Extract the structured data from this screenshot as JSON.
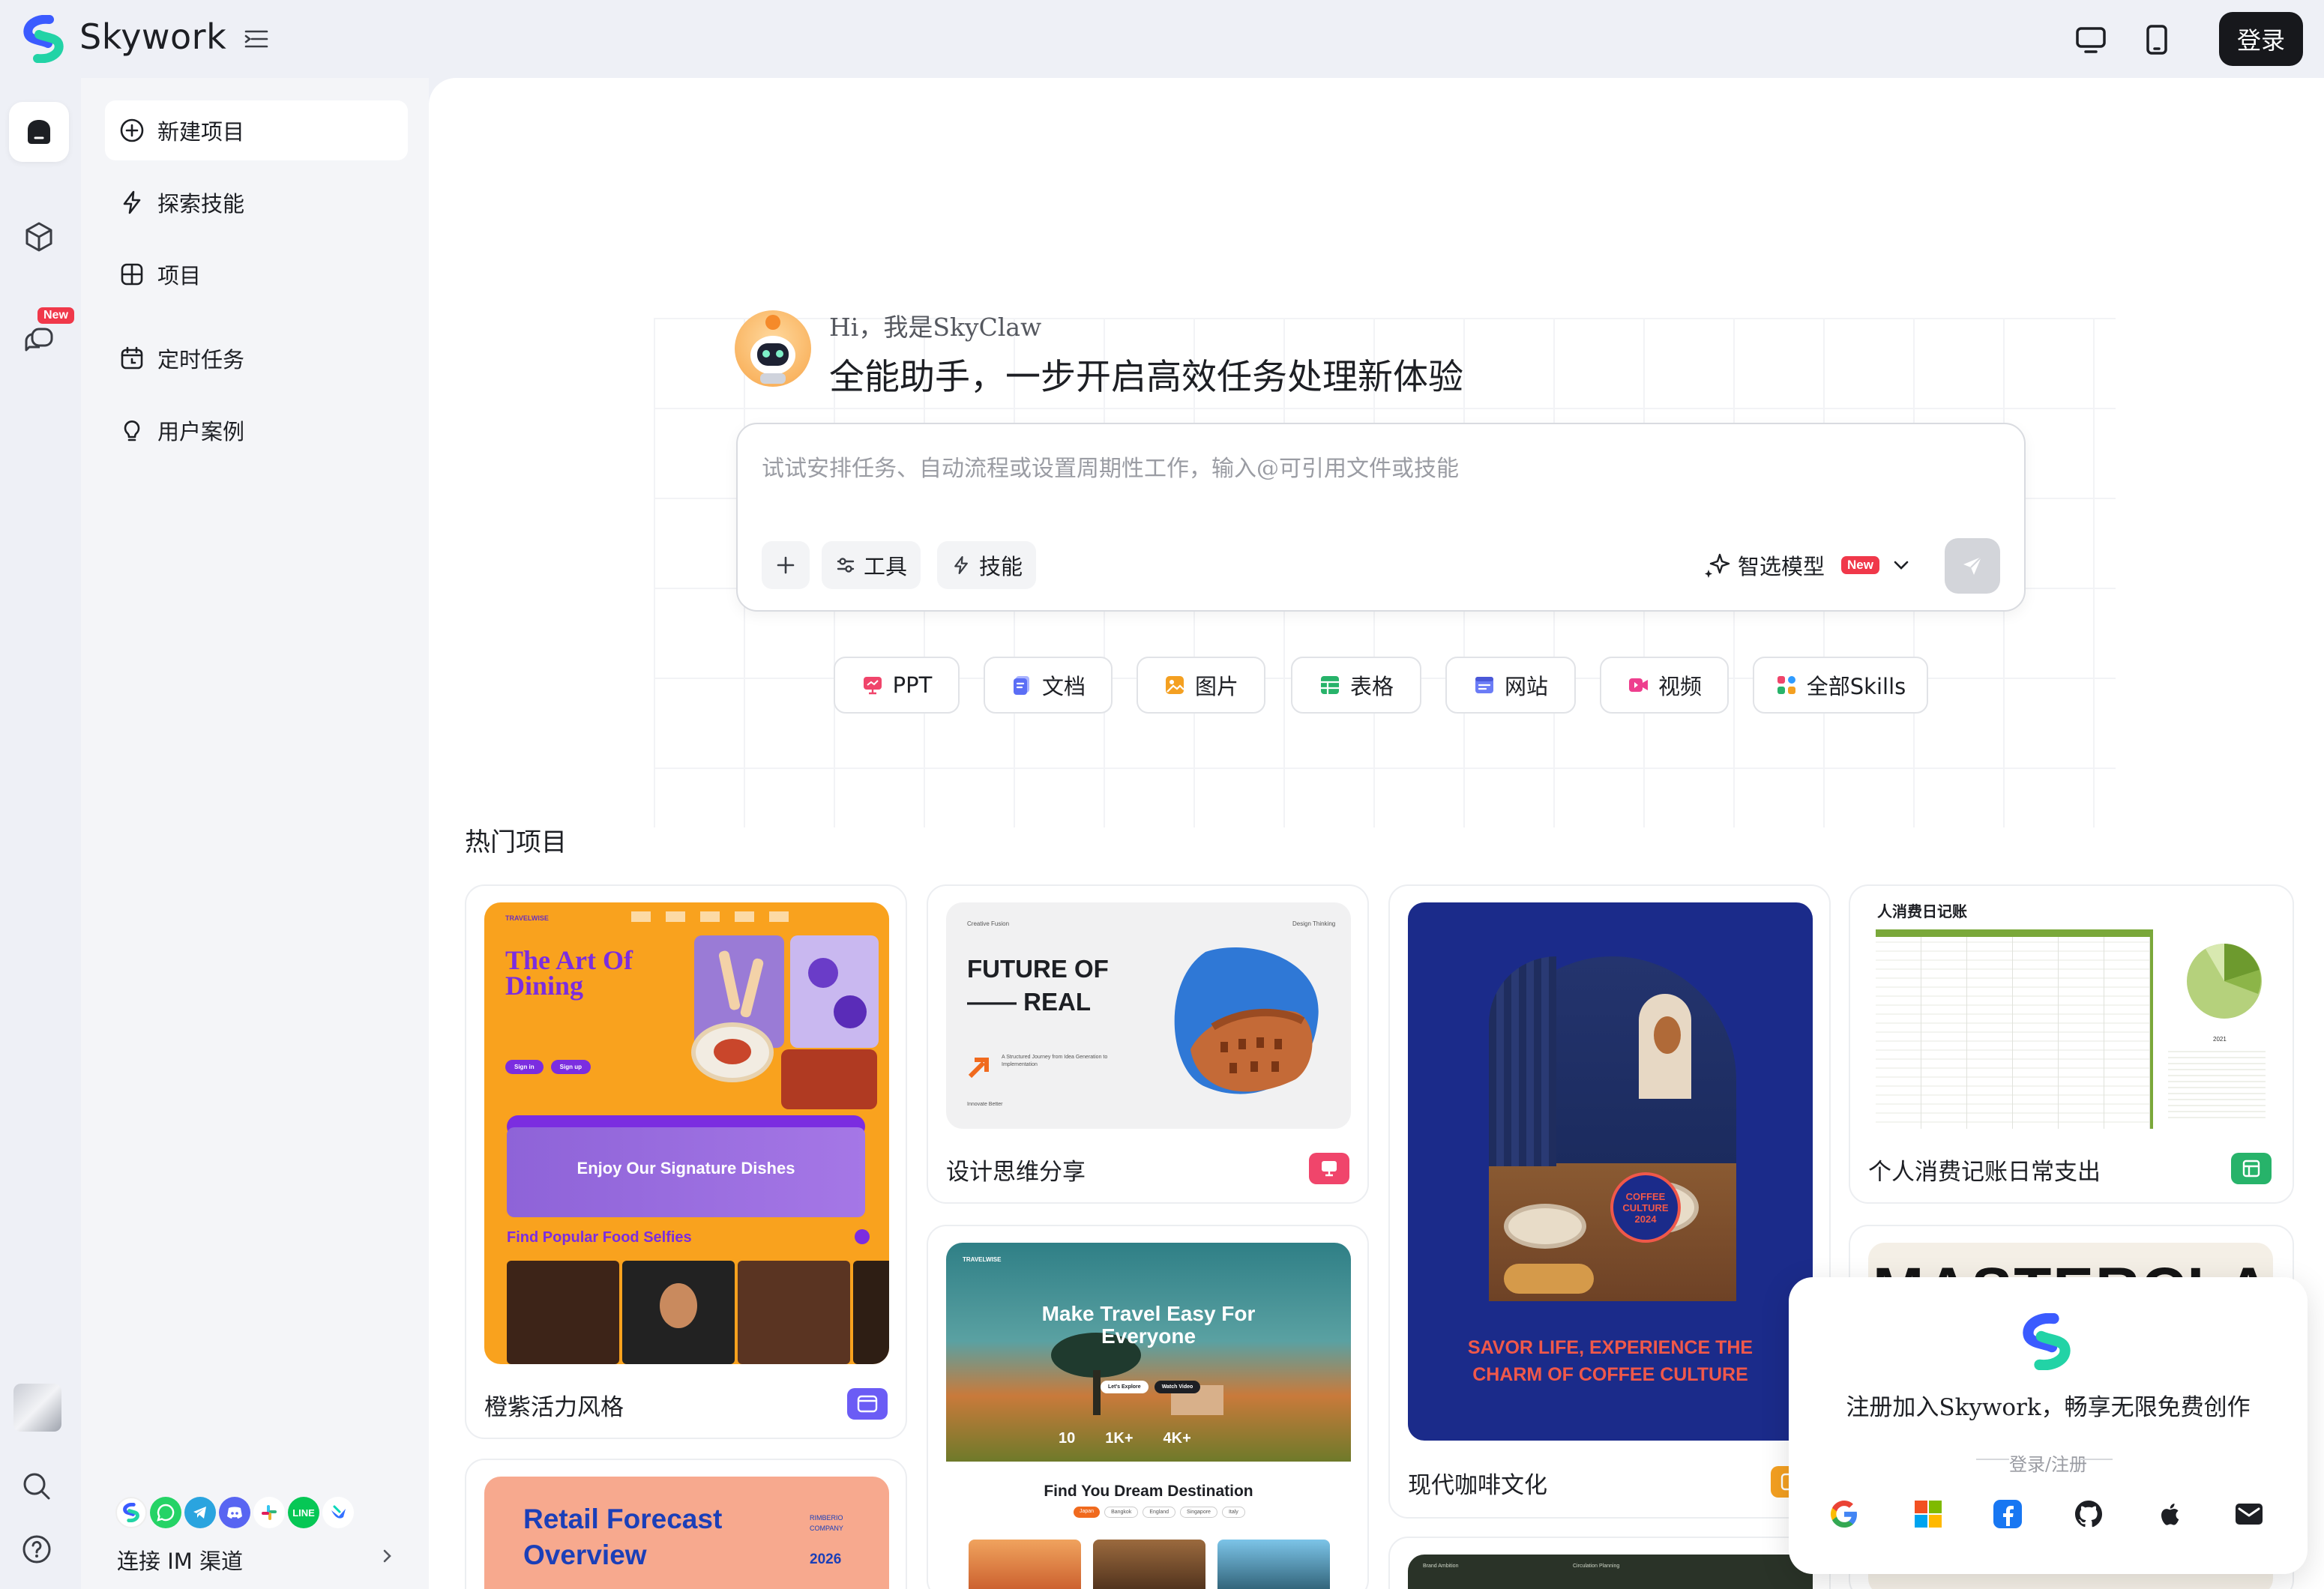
{
  "brand": {
    "name": "Skywork"
  },
  "header": {
    "login_label": "登录"
  },
  "rail": {
    "new_badge": "New"
  },
  "sidebar": {
    "items": [
      {
        "label": "新建项目"
      },
      {
        "label": "探索技能"
      },
      {
        "label": "项目"
      },
      {
        "label": "定时任务"
      },
      {
        "label": "用户案例"
      }
    ],
    "im_label": "连接 IM 渠道"
  },
  "hero": {
    "greeting": "Hi，我是SkyClaw",
    "title": "全能助手，一步开启高效任务处理新体验"
  },
  "composer": {
    "placeholder": "试试安排任务、自动流程或设置周期性工作，输入@可引用文件或技能",
    "tools_label": "工具",
    "skills_label": "技能",
    "model_label": "智选模型",
    "model_badge": "New"
  },
  "categories": [
    {
      "label": "PPT",
      "color": "#f0456b"
    },
    {
      "label": "文档",
      "color": "#5b6ef5"
    },
    {
      "label": "图片",
      "color": "#f4a021"
    },
    {
      "label": "表格",
      "color": "#27b36a"
    },
    {
      "label": "网站",
      "color": "#6b7cf6"
    },
    {
      "label": "视频",
      "color": "#ee3f8e"
    },
    {
      "label": "全部Skills",
      "color": "#2f9bff"
    }
  ],
  "section": {
    "title": "热门项目"
  },
  "projects": [
    {
      "title": "橙紫活力风格",
      "thumb": {
        "brand": "TRAVELWISE",
        "headline": "The Art Of Dining",
        "banner": "Enjoy Our Signature Dishes",
        "sub": "Find Popular Food Selfies",
        "btn1": "Sign in",
        "btn2": "Sign up"
      },
      "icon_color": "#6b5cf5"
    },
    {
      "title": "设计思维分享",
      "thumb": {
        "top_left": "Creative Fusion",
        "top_right": "Design Thinking",
        "headline1": "FUTURE OF",
        "headline2": "—— REAL",
        "caption": "A Structured Journey from Idea Generation to Implementation",
        "footer": "Innovate Better"
      },
      "icon_color": "#f0456b"
    },
    {
      "title": "Make Travel Easy For Everyone",
      "thumb": {
        "brand": "TRAVELWISE",
        "headline": "Make Travel Easy For Everyone",
        "stat1": "10",
        "stat2": "1K+",
        "stat3": "4K+",
        "btn1": "Let's Explore",
        "btn2": "Watch Video",
        "sub": "Find You Dream Destination",
        "tags": [
          "Japan",
          "Bangkok",
          "England",
          "Singapore",
          "Italy"
        ]
      }
    },
    {
      "title": "现代咖啡文化",
      "thumb": {
        "badge1": "COFFEE",
        "badge2": "CULTURE",
        "badge3": "2024",
        "tagline1": "SAVOR LIFE, EXPERIENCE THE",
        "tagline2": "CHARM OF COFFEE CULTURE"
      },
      "icon_color": "#f4a021"
    },
    {
      "title": "个人消费记账日常支出",
      "thumb": {
        "heading": "人消费日记账",
        "chart_year": "2021"
      },
      "icon_color": "#27b36a"
    },
    {
      "title": "Retail Forecast Overview",
      "thumb": {
        "headline1": "Retail Forecast",
        "headline2": "Overview",
        "company1": "RIMBERIO",
        "company2": "COMPANY",
        "year": "2026"
      }
    },
    {
      "title": "MASTERCLASS",
      "thumb": {
        "headline": "MASTERCLASS"
      }
    },
    {
      "title": "Brand Ambition",
      "thumb": {
        "left": "Brand Ambition",
        "right": "Circulation Planning"
      }
    }
  ],
  "popup": {
    "text": "注册加入Skywork，畅享无限免费创作",
    "sub": "登录/注册",
    "providers": [
      "google-icon",
      "microsoft-icon",
      "facebook-icon",
      "github-icon",
      "apple-icon",
      "email-icon"
    ]
  }
}
